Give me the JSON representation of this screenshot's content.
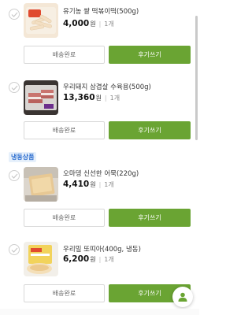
{
  "items": [
    {
      "name": "유기농 쌀 떡볶이떡(500g)",
      "price": "4,000",
      "won": "원",
      "qty": "1개",
      "delivered_label": "배송완료",
      "review_label": "후기쓰기"
    },
    {
      "name": "우리돼지 삼겹살 수육용(500g)",
      "price": "13,360",
      "won": "원",
      "qty": "1개",
      "delivered_label": "배송완료",
      "review_label": "후기쓰기"
    },
    {
      "name": "오마뎅 신선한 어묵(220g)",
      "price": "4,410",
      "won": "원",
      "qty": "1개",
      "delivered_label": "배송완료",
      "review_label": "후기쓰기"
    },
    {
      "name": "우리밀 또띠아(400g, 냉동)",
      "price": "6,200",
      "won": "원",
      "qty": "1개",
      "delivered_label": "배송완료",
      "review_label": "후기쓰기"
    }
  ],
  "sections": {
    "frozen_label": "냉동상품"
  },
  "colors": {
    "accent": "#6aa433",
    "section_bg": "#e6f0fb",
    "section_text": "#2e6fd0"
  },
  "icons": {
    "check": "check-circle-icon",
    "fab": "user-icon"
  }
}
